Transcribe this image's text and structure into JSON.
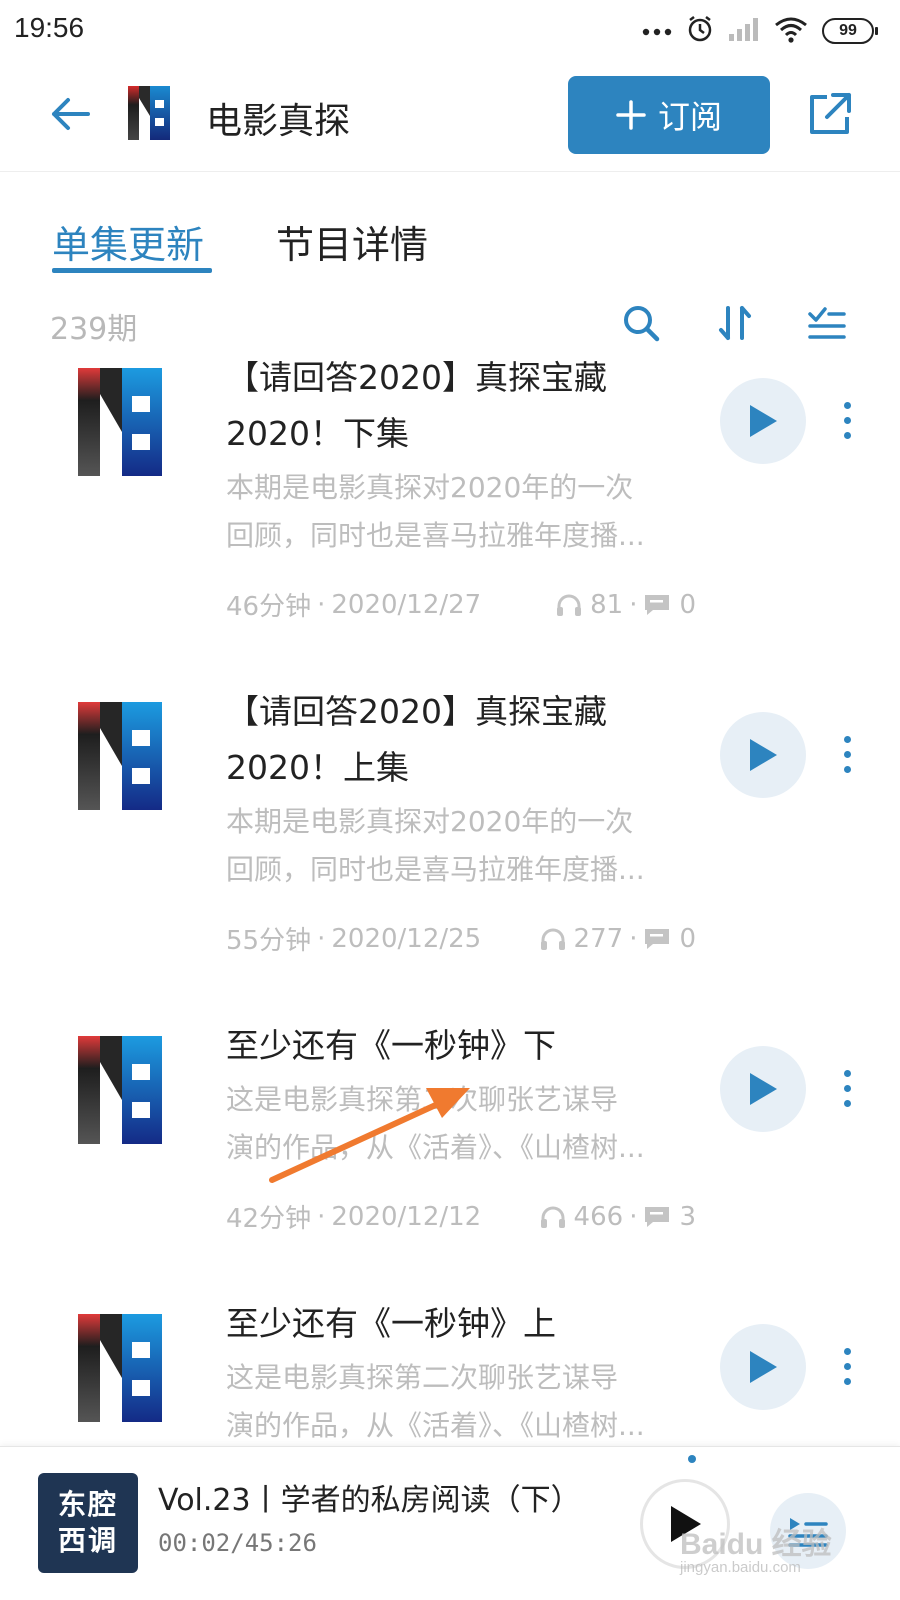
{
  "status_bar": {
    "time": "19:56",
    "battery": "99",
    "icons": [
      "more-dots-icon",
      "alarm-icon",
      "signal-icon",
      "wifi-icon",
      "battery-icon"
    ]
  },
  "header": {
    "title": "电影真探",
    "subscribe_label": "订阅",
    "icons": [
      "back-arrow-icon",
      "podcast-logo",
      "plus-icon",
      "share-icon"
    ]
  },
  "tabs": [
    {
      "label": "单集更新",
      "active": true
    },
    {
      "label": "节目详情",
      "active": false
    }
  ],
  "toolbar": {
    "episode_count": "239期",
    "icons": [
      "search-icon",
      "sort-icon",
      "multi-select-icon"
    ]
  },
  "episodes": [
    {
      "title": "【请回答2020】真探宝藏2020！下集",
      "title_lines": [
        "【请回答2020】真探宝藏",
        "2020！下集"
      ],
      "desc_lines": [
        "本期是电影真探对2020年的一次",
        "回顾，同时也是喜马拉雅年度播..."
      ],
      "duration": "46分钟",
      "date": "2020/12/27",
      "plays": "81",
      "comments": "0"
    },
    {
      "title": "【请回答2020】真探宝藏2020！上集",
      "title_lines": [
        "【请回答2020】真探宝藏",
        "2020！上集"
      ],
      "desc_lines": [
        "本期是电影真探对2020年的一次",
        "回顾，同时也是喜马拉雅年度播..."
      ],
      "duration": "55分钟",
      "date": "2020/12/25",
      "plays": "277",
      "comments": "0"
    },
    {
      "title": "至少还有《一秒钟》下",
      "title_lines": [
        "至少还有《一秒钟》下"
      ],
      "desc_lines": [
        "这是电影真探第二次聊张艺谋导",
        "演的作品，从《活着》、《山楂树..."
      ],
      "duration": "42分钟",
      "date": "2020/12/12",
      "plays": "466",
      "comments": "3"
    },
    {
      "title": "至少还有《一秒钟》上",
      "title_lines": [
        "至少还有《一秒钟》上"
      ],
      "desc_lines": [
        "这是电影真探第二次聊张艺谋导",
        "演的作品，从《活着》、《山楂树..."
      ],
      "duration": "",
      "date": "",
      "plays": "",
      "comments": ""
    }
  ],
  "player": {
    "cover_text_line1": "东腔",
    "cover_text_line2": "西调",
    "title": "Vol.23丨学者的私房阅读（下）",
    "time": "00:02/45:26",
    "icons": [
      "play-icon",
      "playlist-icon"
    ]
  },
  "watermark": {
    "text": "Baidu 经验",
    "url": "jingyan.baidu.com"
  },
  "colors": {
    "accent": "#2d84bf",
    "play_bg": "#e7eff6",
    "muted_text": "#bdbdbd",
    "annotation_arrow": "#f07a2f"
  }
}
